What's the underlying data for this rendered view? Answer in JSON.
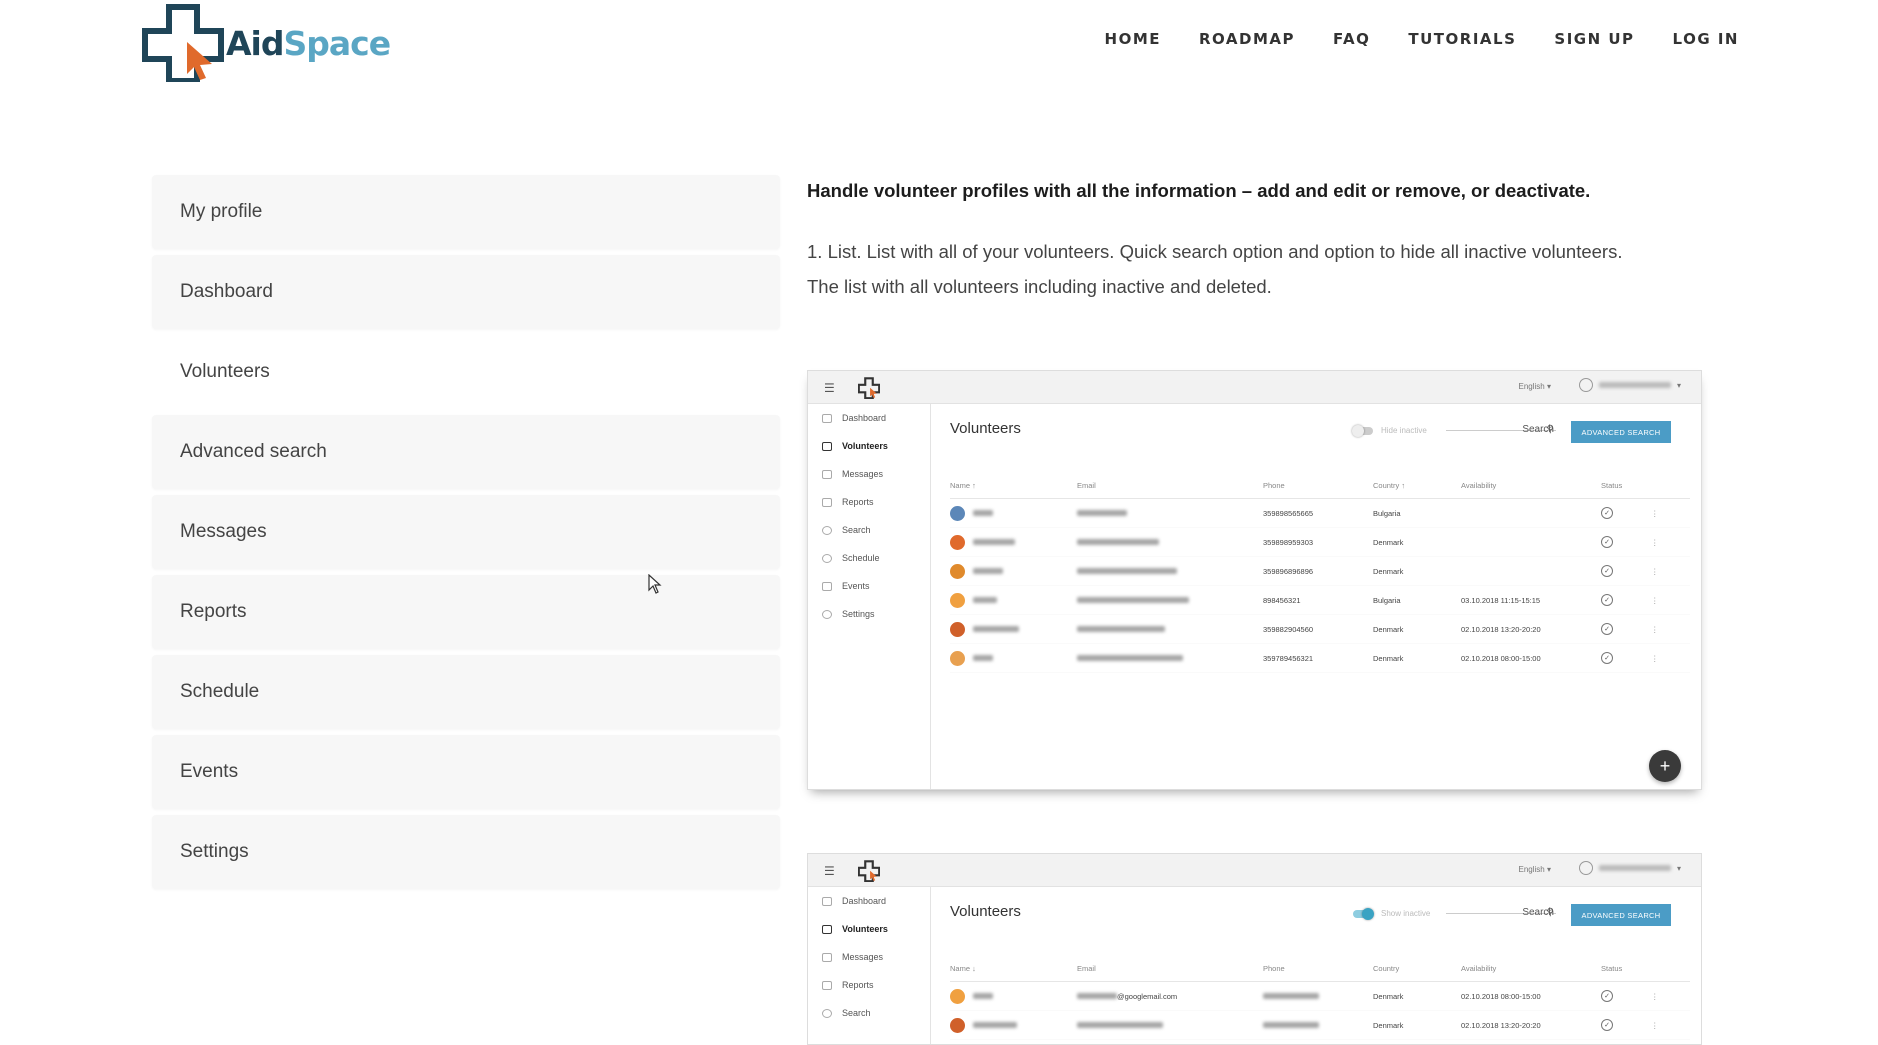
{
  "logo": {
    "text_a": "Aid",
    "text_b": "Space"
  },
  "nav": [
    "HOME",
    "ROADMAP",
    "FAQ",
    "TUTORIALS",
    "SIGN UP",
    "LOG IN"
  ],
  "sidebar": {
    "items": [
      "My profile",
      "Dashboard",
      "Volunteers",
      "Advanced search",
      "Messages",
      "Reports",
      "Schedule",
      "Events",
      "Settings"
    ],
    "active": "Volunteers"
  },
  "content": {
    "intro": "Handle volunteer profiles with all the information – add and edit or remove, or deactivate.",
    "paragraph": "1. List. List with all of your volunteers. Quick search option and option to hide all inactive volunteers. The list with all volunteers including inactive and deleted."
  },
  "screenshot1": {
    "lang": "English",
    "menu": [
      "Dashboard",
      "Volunteers",
      "Messages",
      "Reports",
      "Search",
      "Schedule",
      "Events",
      "Settings"
    ],
    "title": "Volunteers",
    "toggle_label": "Hide inactive",
    "search_placeholder": "Search",
    "button": "ADVANCED SEARCH",
    "headers": [
      "Name ↑",
      "Email",
      "Phone",
      "Country ↑",
      "Availability",
      "Status"
    ],
    "rows": [
      {
        "phone": "359898565665",
        "country": "Bulgaria",
        "availability": ""
      },
      {
        "phone": "359898959303",
        "country": "Denmark",
        "availability": ""
      },
      {
        "phone": "359896896896",
        "country": "Denmark",
        "availability": ""
      },
      {
        "phone": "898456321",
        "country": "Bulgaria",
        "availability": "03.10.2018 11:15-15:15"
      },
      {
        "phone": "359882904560",
        "country": "Denmark",
        "availability": "02.10.2018 13:20-20:20"
      },
      {
        "phone": "359789456321",
        "country": "Denmark",
        "availability": "02.10.2018 08:00-15:00"
      }
    ],
    "fab": "+"
  },
  "screenshot2": {
    "lang": "English",
    "menu": [
      "Dashboard",
      "Volunteers",
      "Messages",
      "Reports",
      "Search"
    ],
    "title": "Volunteers",
    "toggle_label": "Show inactive",
    "search_placeholder": "Search",
    "button": "ADVANCED SEARCH",
    "headers": [
      "Name ↓",
      "Email",
      "Phone",
      "Country",
      "Availability",
      "Status"
    ],
    "rows": [
      {
        "email": "@googlemail.com",
        "country": "Denmark",
        "availability": "02.10.2018 08:00-15:00"
      },
      {
        "email": "",
        "country": "Denmark",
        "availability": "02.10.2018 13:20-20:20"
      }
    ]
  },
  "colors": {
    "brand_dark": "#1f4558",
    "brand_light": "#5aa6c4",
    "accent_orange": "#e06a2c",
    "button_blue": "#4b9cc6"
  }
}
